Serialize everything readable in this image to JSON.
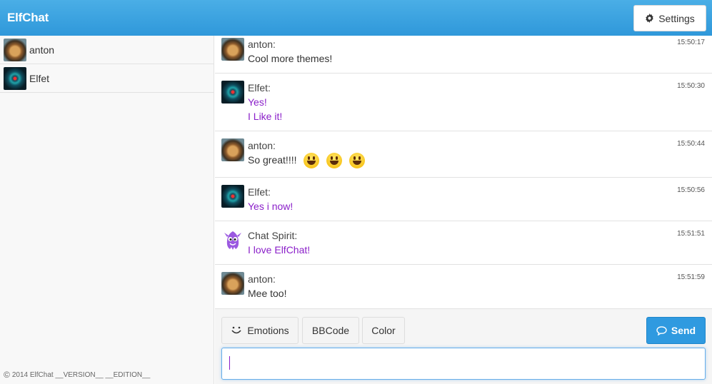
{
  "app": {
    "title": "ElfChat"
  },
  "header": {
    "settings_label": "Settings"
  },
  "sidebar": {
    "users": [
      {
        "name": "anton",
        "avatar": "tiger"
      },
      {
        "name": "Elfet",
        "avatar": "nebula"
      }
    ],
    "footer": "2014 ElfChat __VERSION__ __EDITION__"
  },
  "messages": [
    {
      "author": "anton:",
      "time": "15:50:17",
      "lines": [
        "Cool more themes!"
      ],
      "color": "default",
      "avatar": "tiger"
    },
    {
      "author": "Elfet:",
      "time": "15:50:30",
      "lines": [
        "Yes!",
        "I Like it!"
      ],
      "color": "purple",
      "avatar": "nebula"
    },
    {
      "author": "anton:",
      "time": "15:50:44",
      "lines": [
        "So great!!!!"
      ],
      "color": "default",
      "avatar": "tiger",
      "emoji_count": 3
    },
    {
      "author": "Elfet:",
      "time": "15:50:56",
      "lines": [
        "Yes i now!"
      ],
      "color": "purple",
      "avatar": "nebula"
    },
    {
      "author": "Chat Spirit:",
      "time": "15:51:51",
      "lines": [
        "I love ElfChat!"
      ],
      "color": "purple",
      "avatar": "spirit"
    },
    {
      "author": "anton:",
      "time": "15:51:59",
      "lines": [
        "Mee too!"
      ],
      "color": "default",
      "avatar": "tiger"
    }
  ],
  "composer": {
    "emotions_label": "Emotions",
    "bbcode_label": "BBCode",
    "color_label": "Color",
    "send_label": "Send",
    "input_value": ""
  },
  "colors": {
    "accent": "#2f98da",
    "message_purple": "#8a1fc9"
  }
}
